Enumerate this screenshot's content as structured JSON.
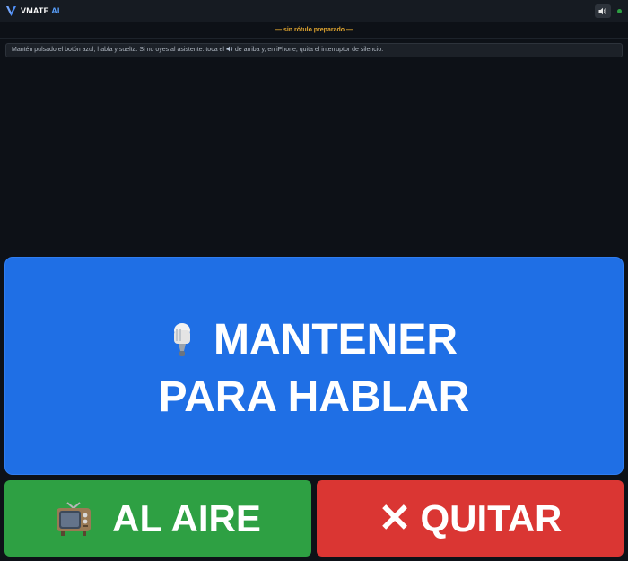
{
  "header": {
    "brand_name": "VMATE",
    "brand_suffix": "AI",
    "logo_icon": "v-logo-icon",
    "sound_icon": "speaker-icon",
    "status_color": "#2ea043"
  },
  "label_bar": {
    "text": "— sin rótulo preparado —"
  },
  "hint": {
    "text_before": "Mantén pulsado el botón azul, habla y suelta. Si no oyes al asistente: toca el",
    "text_after": "de arriba y, en iPhone, quita el interruptor de silencio."
  },
  "talk_button": {
    "line1": "MANTENER",
    "line2": "PARA HABLAR",
    "icon": "microphone-icon",
    "color": "#1f6fe5"
  },
  "onair_button": {
    "label": "AL AIRE",
    "icon": "television-icon",
    "color": "#2ea043"
  },
  "quit_button": {
    "label": "QUITAR",
    "glyph": "✕",
    "icon": "close-icon",
    "color": "#da3633"
  }
}
